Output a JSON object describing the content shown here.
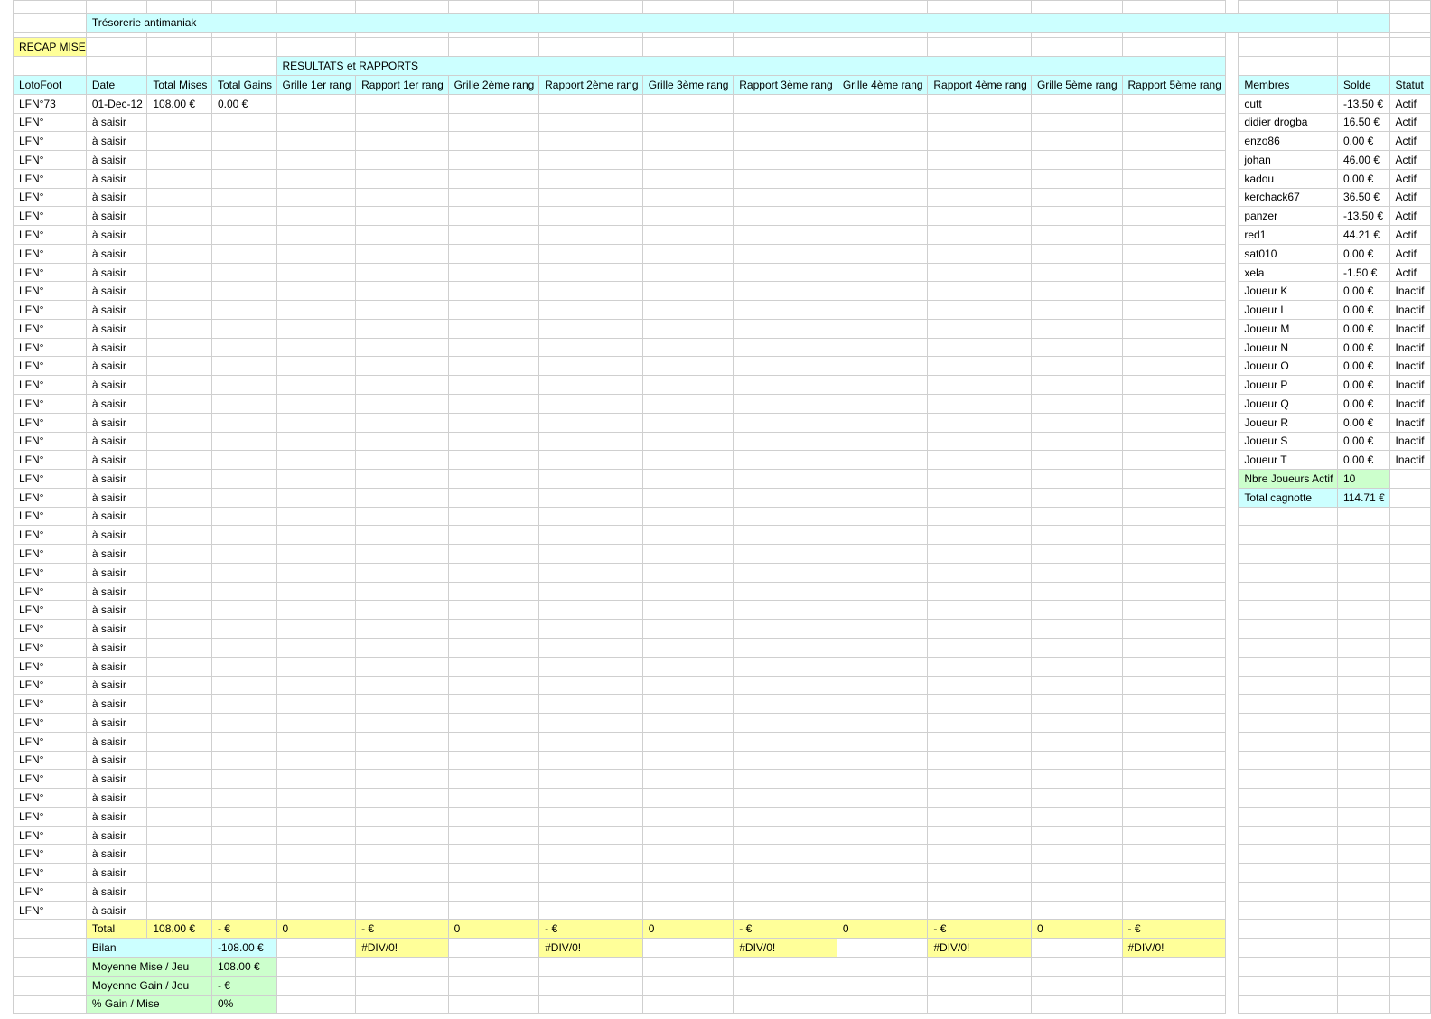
{
  "title": "Trésorerie antimaniak",
  "recap_label": "RECAP MISE",
  "section_label": "RESULTATS et RAPPORTS",
  "headers": [
    "LotoFoot",
    "Date",
    "Total Mises",
    "Total Gains",
    "Grille 1er rang",
    "Rapport 1er rang",
    "Grille 2ème rang",
    "Rapport 2ème rang",
    "Grille 3ème rang",
    "Rapport 3ème rang",
    "Grille 4ème rang",
    "Rapport 4ème rang",
    "Grille 5ème rang",
    "Rapport 5ème rang"
  ],
  "first_row": {
    "lotofoot": "LFN°73",
    "date": "01-Dec-12",
    "total_mises": "108.00 €",
    "total_gains": "0.00 €"
  },
  "placeholder_row": {
    "lotofoot": "LFN°",
    "date": "à saisir"
  },
  "placeholder_row_count": 43,
  "members_headers": [
    "Membres",
    "Solde",
    "Statut"
  ],
  "members": [
    {
      "name": "cutt",
      "solde": "-13.50 €",
      "statut": "Actif"
    },
    {
      "name": "didier drogba",
      "solde": "16.50 €",
      "statut": "Actif"
    },
    {
      "name": "enzo86",
      "solde": "0.00 €",
      "statut": "Actif"
    },
    {
      "name": "johan",
      "solde": "46.00 €",
      "statut": "Actif"
    },
    {
      "name": "kadou",
      "solde": "0.00 €",
      "statut": "Actif"
    },
    {
      "name": "kerchack67",
      "solde": "36.50 €",
      "statut": "Actif"
    },
    {
      "name": "panzer",
      "solde": "-13.50 €",
      "statut": "Actif"
    },
    {
      "name": "red1",
      "solde": "44.21 €",
      "statut": "Actif"
    },
    {
      "name": "sat010",
      "solde": "0.00 €",
      "statut": "Actif"
    },
    {
      "name": "xela",
      "solde": "-1.50 €",
      "statut": "Actif"
    },
    {
      "name": "Joueur K",
      "solde": "0.00 €",
      "statut": "Inactif"
    },
    {
      "name": "Joueur L",
      "solde": "0.00 €",
      "statut": "Inactif"
    },
    {
      "name": "Joueur M",
      "solde": "0.00 €",
      "statut": "Inactif"
    },
    {
      "name": "Joueur N",
      "solde": "0.00 €",
      "statut": "Inactif"
    },
    {
      "name": "Joueur O",
      "solde": "0.00 €",
      "statut": "Inactif"
    },
    {
      "name": "Joueur P",
      "solde": "0.00 €",
      "statut": "Inactif"
    },
    {
      "name": "Joueur Q",
      "solde": "0.00 €",
      "statut": "Inactif"
    },
    {
      "name": "Joueur R",
      "solde": "0.00 €",
      "statut": "Inactif"
    },
    {
      "name": "Joueur S",
      "solde": "0.00 €",
      "statut": "Inactif"
    },
    {
      "name": "Joueur T",
      "solde": "0.00 €",
      "statut": "Inactif"
    }
  ],
  "member_summary": {
    "active_label": "Nbre Joueurs Actif",
    "active_value": "10",
    "total_label": "Total cagnotte",
    "total_value": "114.71 €"
  },
  "totals_row": [
    "Total",
    "108.00 €",
    "- €",
    "0",
    "- €",
    "0",
    "- €",
    "0",
    "- €",
    "0",
    "- €",
    "0",
    "- €"
  ],
  "bilan_row": {
    "label": "Bilan",
    "value": "-108.00 €",
    "div_error": "#DIV/0!"
  },
  "stats": [
    {
      "label": "Moyenne Mise / Jeu",
      "value": "108.00 €"
    },
    {
      "label": "Moyenne Gain / Jeu",
      "value": "- €"
    },
    {
      "label": "% Gain / Mise",
      "value": "0%"
    }
  ],
  "colors": {
    "cyan": "#ccffff",
    "yellow": "#ffff99",
    "green": "#ccffcc",
    "grid": "#cfcfcf"
  }
}
